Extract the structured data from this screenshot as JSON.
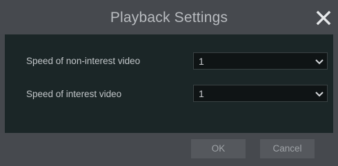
{
  "dialog": {
    "title": "Playback Settings",
    "close_icon": "close-icon"
  },
  "settings": [
    {
      "label": "Speed of non-interest video",
      "value": "1",
      "icon": "chevron-down-icon"
    },
    {
      "label": "Speed of interest video",
      "value": "1",
      "icon": "chevron-down-icon"
    }
  ],
  "buttons": {
    "ok_label": "OK",
    "cancel_label": "Cancel"
  },
  "colors": {
    "frame": "#46494e",
    "panel": "#1b2627",
    "field": "#0f1415",
    "text": "#c2c6c9",
    "button": "#55585d"
  }
}
